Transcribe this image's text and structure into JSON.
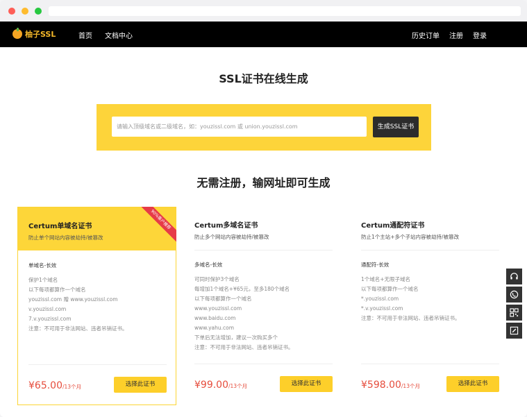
{
  "navbar": {
    "logo_text": "柚子SSL",
    "links": [
      "首页",
      "文档中心"
    ],
    "right_links": [
      "历史订单",
      "注册",
      "登录"
    ]
  },
  "hero": {
    "title": "SSL证书在线生成",
    "search_placeholder": "请输入顶级域名或二级域名，如：youzissl.com 或 union.youzissl.com",
    "search_button": "生成SSL证书"
  },
  "section": {
    "title": "无需注册，输网址即可生成"
  },
  "cards": [
    {
      "name": "Certum单域名证书",
      "desc": "防止单个网站内容被劫持/被篡改",
      "type": "单域名-长效",
      "lines": [
        "保护1个域名",
        "以下每项都算作一个域名",
        "youzissl.com 赠 www.youzissl.com",
        "v.youzissl.com",
        "7.v.youzissl.com",
        "注意：不可用于非法网站、违者吊销证书。"
      ],
      "price": "¥65.00",
      "price_unit": "/13个月",
      "button": "选择此证书",
      "ribbon": "90%客户推荐"
    },
    {
      "name": "Certum多域名证书",
      "desc": "防止多个网站内容被劫持/被篡改",
      "type": "多域名-长效",
      "lines": [
        "可同时保护3个域名",
        "每增加1个域名+¥65元，至多180个域名",
        "以下每项都算作一个域名",
        "www.youzissl.com",
        "www.baidu.com",
        "www.yahu.com",
        "下单后无法增加，建议一次购买多个",
        "注意：不可用于非法网站、违者吊销证书。"
      ],
      "price": "¥99.00",
      "price_unit": "/13个月",
      "button": "选择此证书"
    },
    {
      "name": "Certum通配符证书",
      "desc": "防止1个主站+多个子站内容被劫持/被篡改",
      "type": "通配符-长效",
      "lines": [
        "1个域名+无限子域名",
        "以下每项都算作一个域名",
        "*.youzissl.com",
        "*.v.youzissl.com",
        "注意：不可用于非法网站、违者吊销证书。"
      ],
      "price": "¥598.00",
      "price_unit": "/13个月",
      "button": "选择此证书"
    }
  ],
  "side_tools": [
    "headset-icon",
    "phone-icon",
    "qrcode-icon",
    "edit-icon"
  ],
  "colors": {
    "accent": "#fdd43a",
    "price": "#e64c3c",
    "ribbon": "#e63b48",
    "navbar": "#000000"
  }
}
